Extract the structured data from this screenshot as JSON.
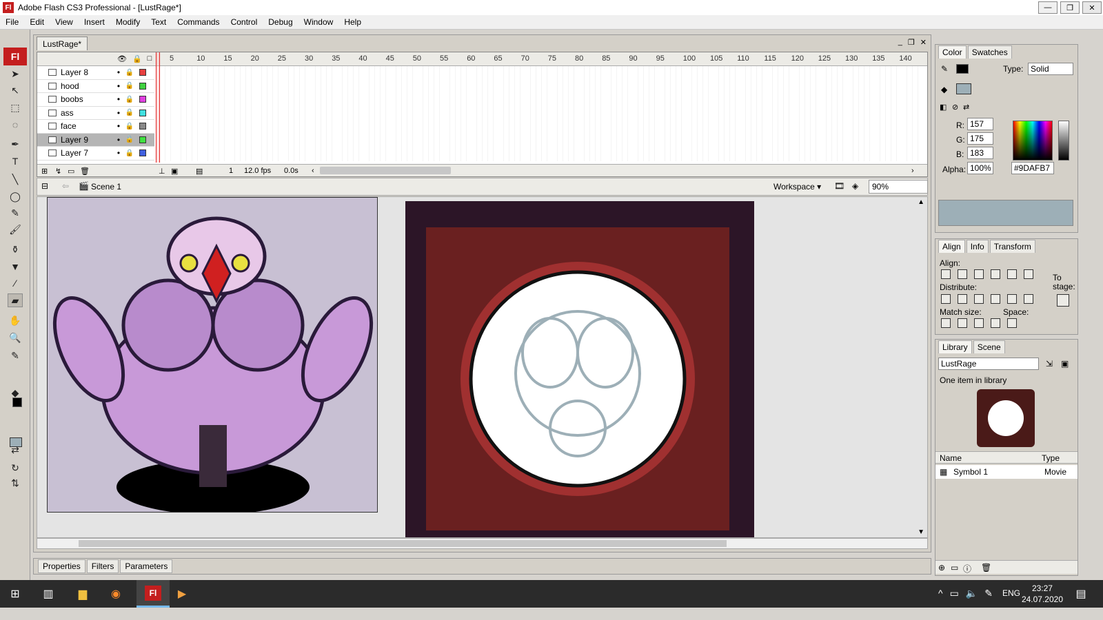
{
  "window": {
    "title": "Adobe Flash CS3 Professional - [LustRage*]",
    "app_icon": "Fl",
    "minimize": "—",
    "maximize": "❐",
    "close": "✕"
  },
  "menu": [
    "File",
    "Edit",
    "View",
    "Insert",
    "Modify",
    "Text",
    "Commands",
    "Control",
    "Debug",
    "Window",
    "Help"
  ],
  "tools": {
    "logo": "Fl",
    "items": [
      "selection-icon",
      "subselection-icon",
      "free-transform-icon",
      "lasso-icon",
      "pen-icon",
      "text-icon",
      "line-icon",
      "oval-icon",
      "pencil-icon",
      "brush-icon",
      "ink-bottle-icon",
      "paint-bucket-icon",
      "eyedropper-icon",
      "eraser-icon",
      "hand-icon",
      "zoom-icon"
    ],
    "stroke_color": "#000000",
    "fill_color": "#9DAFB7"
  },
  "document": {
    "tab": "LustRage*",
    "frame_numbers": [
      "5",
      "10",
      "15",
      "20",
      "25",
      "30",
      "35",
      "40",
      "45",
      "50",
      "55",
      "60",
      "65",
      "70",
      "75",
      "80",
      "85",
      "90",
      "95",
      "100",
      "105",
      "110",
      "115",
      "120",
      "125",
      "130",
      "135",
      "140"
    ],
    "layers": [
      {
        "name": "Layer 8",
        "color": "#e84040",
        "selected": false
      },
      {
        "name": "hood",
        "color": "#40d040",
        "selected": false
      },
      {
        "name": "boobs",
        "color": "#e040e0",
        "selected": false
      },
      {
        "name": "ass",
        "color": "#40e0e0",
        "selected": false
      },
      {
        "name": "face",
        "color": "#888888",
        "selected": false
      },
      {
        "name": "Layer 9",
        "color": "#40e040",
        "selected": true
      },
      {
        "name": "Layer 7",
        "color": "#4060e0",
        "selected": false
      }
    ],
    "status": {
      "frame": "1",
      "fps": "12.0 fps",
      "time": "0.0s"
    },
    "scene": "Scene 1",
    "workspace": "Workspace ▾",
    "zoom": "90%"
  },
  "props_tabs": [
    "Properties",
    "Filters",
    "Parameters"
  ],
  "color_panel": {
    "tabs": [
      "Color",
      "Swatches"
    ],
    "type_label": "Type:",
    "type_value": "Solid",
    "r_label": "R:",
    "r": "157",
    "g_label": "G:",
    "g": "175",
    "b_label": "B:",
    "b": "183",
    "alpha_label": "Alpha:",
    "alpha": "100%",
    "hex": "#9DAFB7",
    "preview_color": "#9DAFB7"
  },
  "align_panel": {
    "tabs": [
      "Align",
      "Info",
      "Transform"
    ],
    "align": "Align:",
    "distribute": "Distribute:",
    "match_size": "Match size:",
    "space": "Space:",
    "to_stage": "To stage:"
  },
  "library_panel": {
    "tabs": [
      "Library",
      "Scene"
    ],
    "dropdown": "LustRage",
    "count": "One item in library",
    "col_name": "Name",
    "col_type": "Type",
    "items": [
      {
        "name": "Symbol 1",
        "type": "Movie"
      }
    ]
  },
  "taskbar": {
    "lang": "ENG",
    "time": "23:27",
    "date": "24.07.2020",
    "active_app": "Fl"
  }
}
